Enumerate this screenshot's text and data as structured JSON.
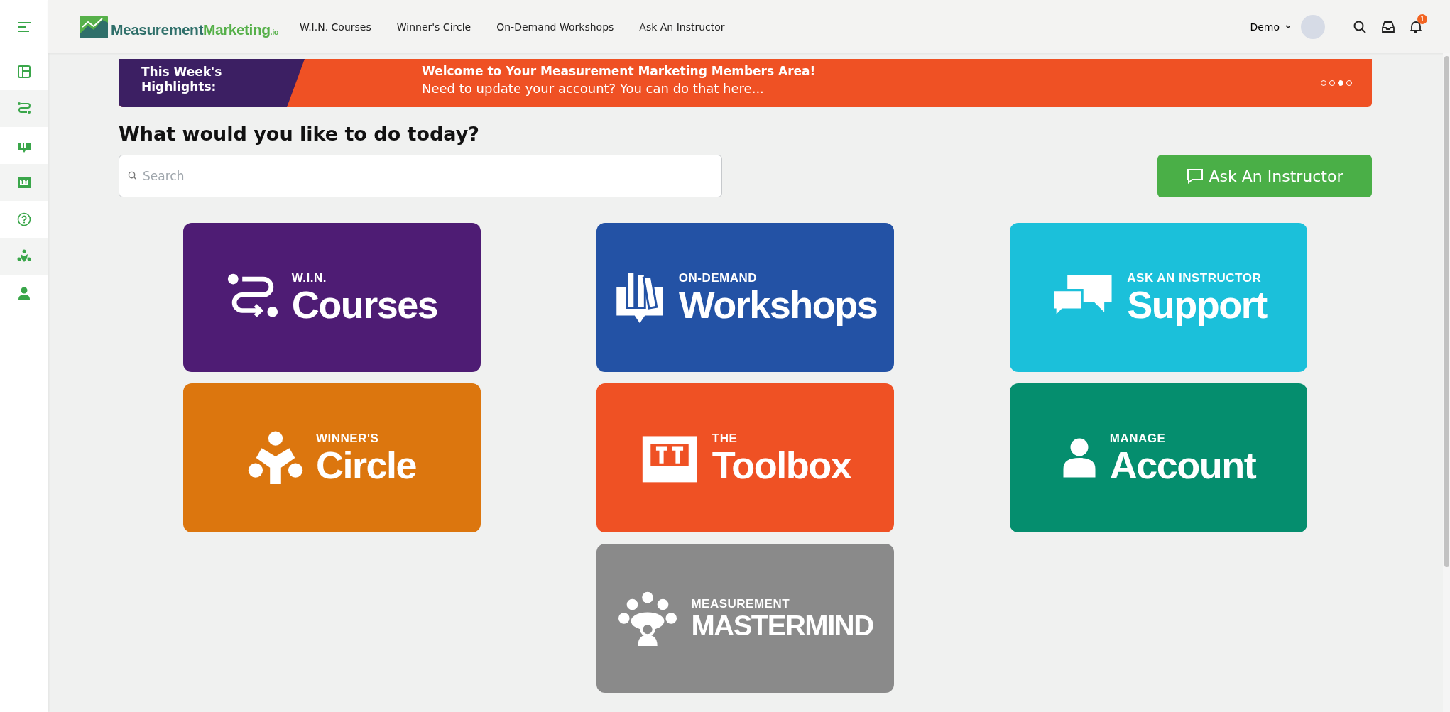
{
  "header": {
    "logo": {
      "name_dark": "Measurement",
      "name_green": "Marketing",
      "suffix": ".io"
    },
    "nav": [
      {
        "label": "W.I.N. Courses"
      },
      {
        "label": "Winner's Circle"
      },
      {
        "label": "On-Demand Workshops"
      },
      {
        "label": "Ask An Instructor"
      }
    ],
    "user": {
      "name": "Demo"
    },
    "notification_count": "1"
  },
  "sidebar": {
    "items": [
      {
        "kind": "dashboard"
      },
      {
        "kind": "courses"
      },
      {
        "kind": "workshops"
      },
      {
        "kind": "toolbox"
      },
      {
        "kind": "help"
      },
      {
        "kind": "circle"
      },
      {
        "kind": "account"
      }
    ]
  },
  "banner": {
    "label_lines": [
      "This Week's",
      "Highlights:"
    ],
    "title": "Welcome to Your Measurement Marketing Members Area!",
    "message": "Need to update your account? You can do that here...",
    "dots": [
      {
        "selected": false
      },
      {
        "selected": false
      },
      {
        "selected": true
      },
      {
        "selected": false
      }
    ]
  },
  "heading": "What would you like to do today?",
  "search": {
    "placeholder": "Search"
  },
  "ask_button": "Ask An Instructor",
  "tiles": [
    {
      "kind": "courses",
      "kicker": "W.I.N.",
      "title": "Courses",
      "color": "#4e1c74"
    },
    {
      "kind": "workshops",
      "kicker": "ON-DEMAND",
      "title": "Workshops",
      "color": "#2352a5"
    },
    {
      "kind": "support",
      "kicker": "ASK AN INSTRUCTOR",
      "title": "Support",
      "color": "#1bc0da"
    },
    {
      "kind": "circle",
      "kicker": "WINNER'S",
      "title": "Circle",
      "color": "#dc760e"
    },
    {
      "kind": "toolbox",
      "kicker": "THE",
      "title": "Toolbox",
      "color": "#ef5124"
    },
    {
      "kind": "account",
      "kicker": "MANAGE",
      "title": "Account",
      "color": "#058e6e"
    },
    {
      "kind": "mastermind",
      "kicker": "MEASUREMENT",
      "title": "MASTERMIND",
      "color": "#8a8a8a"
    }
  ]
}
